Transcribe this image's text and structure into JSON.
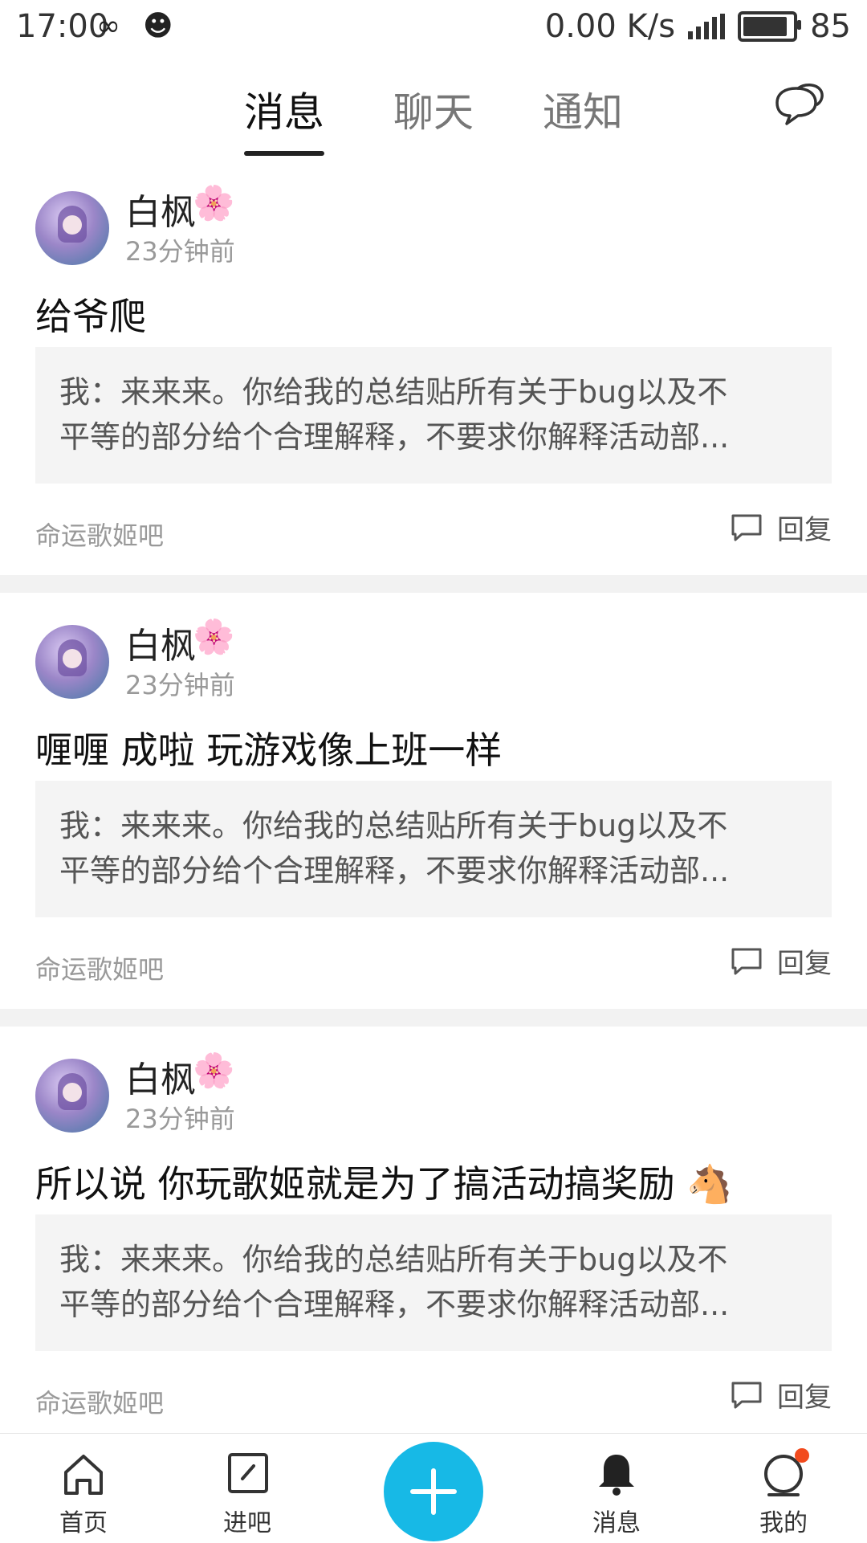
{
  "status_bar": {
    "time": "17:00",
    "net_speed": "0.00 K/s",
    "battery": "85"
  },
  "tabs": [
    {
      "label": "消息",
      "active": true
    },
    {
      "label": "聊天",
      "active": false
    },
    {
      "label": "通知",
      "active": false
    }
  ],
  "posts": [
    {
      "user": "白枫",
      "badge": "🌸",
      "time": "23分钟前",
      "title": "给爷爬",
      "quote_line1": "我：来来来。你给我的总结贴所有关于bug以及不",
      "quote_line2": "平等的部分给个合理解释，不要求你解释活动部...",
      "forum": "命运歌姬吧",
      "reply_label": "回复"
    },
    {
      "user": "白枫",
      "badge": "🌸",
      "time": "23分钟前",
      "title": "喱喱 成啦 玩游戏像上班一样",
      "quote_line1": "我：来来来。你给我的总结贴所有关于bug以及不",
      "quote_line2": "平等的部分给个合理解释，不要求你解释活动部...",
      "forum": "命运歌姬吧",
      "reply_label": "回复"
    },
    {
      "user": "白枫",
      "badge": "🌸",
      "time": "23分钟前",
      "title": "所以说 你玩歌姬就是为了搞活动搞奖励 🐴",
      "quote_line1": "我：来来来。你给我的总结贴所有关于bug以及不",
      "quote_line2": "平等的部分给个合理解释，不要求你解释活动部...",
      "forum": "命运歌姬吧",
      "reply_label": "回复"
    }
  ],
  "bottom_nav": {
    "home": "首页",
    "forums": "进吧",
    "messages": "消息",
    "me": "我的"
  },
  "colors": {
    "accent": "#17b9e6",
    "notification_dot": "#f24a1d"
  }
}
